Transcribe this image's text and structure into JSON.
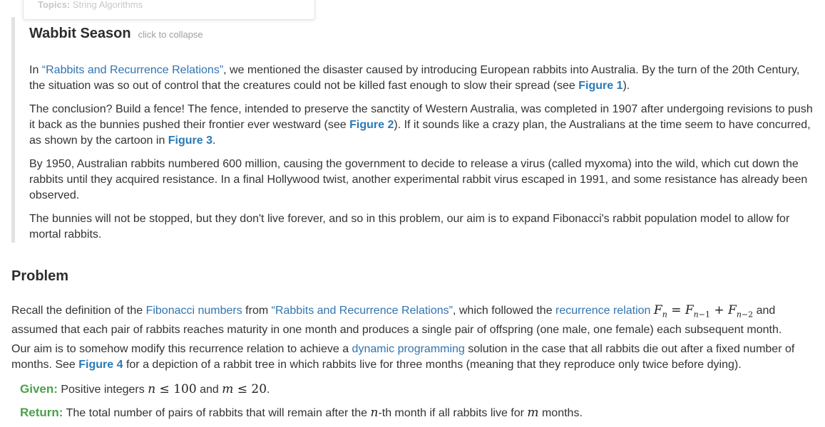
{
  "topics": {
    "label": "Topics:",
    "value": "String Algorithms"
  },
  "story": {
    "title": "Wabbit Season",
    "collapse_hint": "click to collapse",
    "p1": {
      "t1": "In ",
      "link": "“Rabbits and Recurrence Relations”",
      "t2": ", we mentioned the disaster caused by introducing European rabbits into Australia. By the turn of the 20th Century, the situation was so out of control that the creatures could not be killed fast enough to slow their spread (see ",
      "fig": "Figure 1",
      "t3": ")."
    },
    "p2": {
      "t1": "The conclusion? Build a fence! The fence, intended to preserve the sanctity of Western Australia, was completed in 1907 after undergoing revisions to push it back as the bunnies pushed their frontier ever westward (see ",
      "fig1": "Figure 2",
      "t2": "). If it sounds like a crazy plan, the Australians at the time seem to have concurred, as shown by the cartoon in ",
      "fig2": "Figure 3",
      "t3": "."
    },
    "p3": "By 1950, Australian rabbits numbered 600 million, causing the government to decide to release a virus (called myxoma) into the wild, which cut down the rabbits until they acquired resistance. In a final Hollywood twist, another experimental rabbit virus escaped in 1991, and some resistance has already been observed.",
    "p4": "The bunnies will not be stopped, but they don't live forever, and so in this problem, our aim is to expand Fibonacci's rabbit population model to allow for mortal rabbits."
  },
  "problem": {
    "heading": "Problem",
    "p1": {
      "t1": "Recall the definition of the ",
      "link1": "Fibonacci numbers",
      "t2": " from ",
      "link2": "“Rabbits and Recurrence Relations”",
      "t3": ", which followed the ",
      "link3": "recurrence relation",
      "t4": " and assumed that each pair of rabbits reaches maturity in one month and produces a single pair of offspring (one male, one female) each subsequent month."
    },
    "p2": {
      "t1": "Our aim is to somehow modify this recurrence relation to achieve a ",
      "link": "dynamic programming",
      "t2": " solution in the case that all rabbits die out after a fixed number of months. See ",
      "fig": "Figure 4",
      "t3": " for a depiction of a rabbit tree in which rabbits live for three months (meaning that they reproduce only twice before dying)."
    },
    "given": {
      "label": "Given:",
      "t1": " Positive integers ",
      "t2": " and ",
      "t3": "."
    },
    "return": {
      "label": "Return:",
      "t1": " The total number of pairs of rabbits that will remain after the ",
      "t2": "-th month if all rabbits live for ",
      "t3": " months."
    }
  },
  "colors": {
    "link": "#3174b0",
    "figure_link": "#2a7ab5",
    "spec_label": "#4ba04b",
    "story_border": "#e2e2e2"
  }
}
